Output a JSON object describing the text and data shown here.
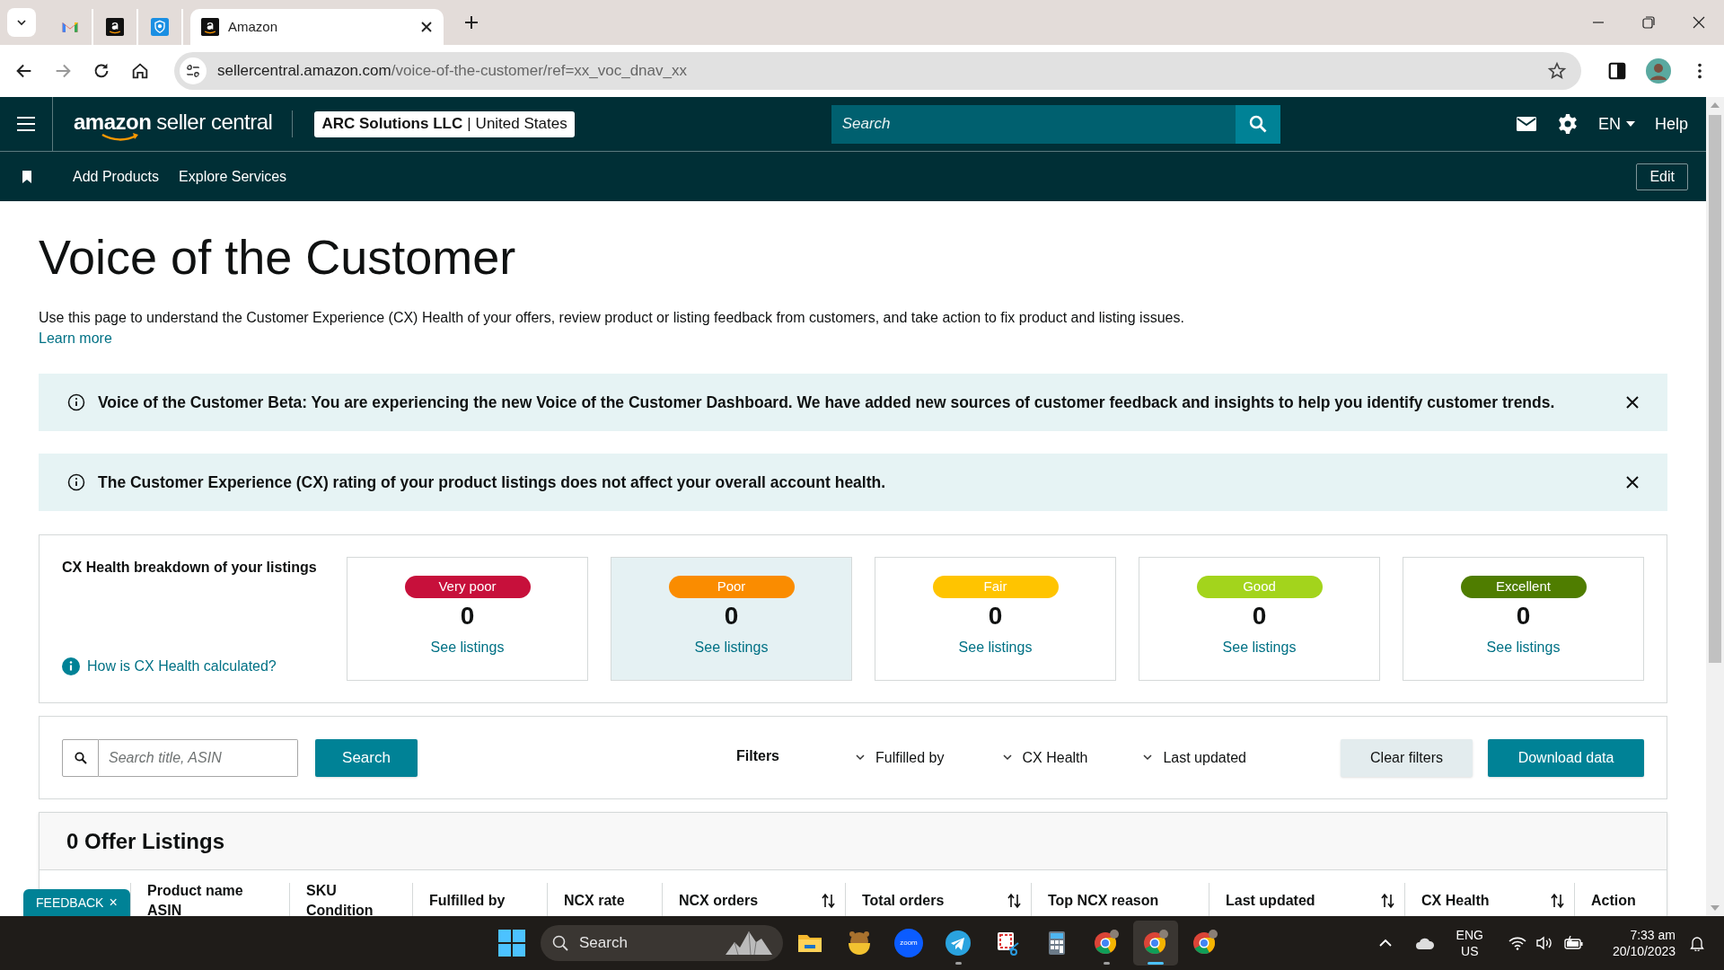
{
  "browser": {
    "tabs": [
      {
        "kind": "mail",
        "selected": false
      },
      {
        "kind": "amazon",
        "selected": false
      },
      {
        "kind": "shield",
        "selected": false
      },
      {
        "kind": "amazon",
        "title": "Amazon",
        "selected": true
      }
    ],
    "url_host": "sellercentral.amazon.com",
    "url_path": "/voice-of-the-customer/ref=xx_voc_dnav_xx"
  },
  "header": {
    "logo_brand": "amazon",
    "logo_product": "seller central",
    "account_name": "ARC Solutions LLC",
    "account_separator": "|",
    "account_region": "United States",
    "search_placeholder": "Search",
    "language": "EN",
    "help": "Help",
    "nav_items": [
      "Add Products",
      "Explore Services"
    ],
    "edit": "Edit"
  },
  "page": {
    "title": "Voice of the Customer",
    "description": "Use this page to understand the Customer Experience (CX) Health of your offers, review product or listing feedback from customers, and take action to fix product and listing issues.",
    "learn_more": "Learn more",
    "alerts": [
      {
        "text": "Voice of the Customer Beta: You are experiencing the new Voice of the Customer Dashboard. We have added new sources of customer feedback and insights to help you identify customer trends."
      },
      {
        "text": "The Customer Experience (CX) rating of your product listings does not affect your overall account health."
      }
    ],
    "cx_health": {
      "title": "CX Health breakdown of your listings",
      "help_link": "How is CX Health calculated?",
      "ratings": [
        {
          "label": "Very poor",
          "count": "0",
          "link": "See listings",
          "color": "#c7103b",
          "selected": false
        },
        {
          "label": "Poor",
          "count": "0",
          "link": "See listings",
          "color": "#fa8c00",
          "selected": true
        },
        {
          "label": "Fair",
          "count": "0",
          "link": "See listings",
          "color": "#ffc400",
          "selected": false
        },
        {
          "label": "Good",
          "count": "0",
          "link": "See listings",
          "color": "#a3d41c",
          "selected": false
        },
        {
          "label": "Excellent",
          "count": "0",
          "link": "See listings",
          "color": "#4f7d00",
          "selected": false
        }
      ]
    },
    "filters": {
      "search_placeholder": "Search title, ASIN",
      "search_button": "Search",
      "label": "Filters",
      "dropdowns": [
        "Fulfilled by",
        "CX Health",
        "Last updated"
      ],
      "clear": "Clear filters",
      "download": "Download data"
    },
    "listings": {
      "title": "0 Offer Listings",
      "columns": [
        {
          "lines": [
            "Product name",
            "ASIN"
          ],
          "sortable": false
        },
        {
          "lines": [
            "SKU",
            "Condition"
          ],
          "sortable": false
        },
        {
          "lines": [
            "Fulfilled by"
          ],
          "sortable": false
        },
        {
          "lines": [
            "NCX rate"
          ],
          "sortable": false
        },
        {
          "lines": [
            "NCX orders"
          ],
          "sortable": true
        },
        {
          "lines": [
            "Total orders"
          ],
          "sortable": true
        },
        {
          "lines": [
            "Top NCX reason"
          ],
          "sortable": false
        },
        {
          "lines": [
            "Last updated"
          ],
          "sortable": true
        },
        {
          "lines": [
            "CX Health"
          ],
          "sortable": true
        },
        {
          "lines": [
            "Action"
          ],
          "sortable": false
        }
      ]
    },
    "feedback": "FEEDBACK",
    "feedback_close": "×"
  },
  "taskbar": {
    "search": "Search",
    "apps": [
      {
        "kind": "folder",
        "running": false,
        "active": false
      },
      {
        "kind": "bear",
        "running": false,
        "active": false
      },
      {
        "kind": "zoom",
        "label": "zoom",
        "running": false,
        "active": false
      },
      {
        "kind": "telegram",
        "running": true,
        "active": false
      },
      {
        "kind": "snip",
        "running": false,
        "active": false
      },
      {
        "kind": "calculator",
        "running": false,
        "active": false
      },
      {
        "kind": "chrome",
        "running": true,
        "active": false
      },
      {
        "kind": "chrome",
        "running": true,
        "active": true
      },
      {
        "kind": "chrome",
        "running": false,
        "active": false
      }
    ],
    "language": "ENG",
    "region": "US",
    "time": "7:33 am",
    "date": "20/10/2023"
  }
}
